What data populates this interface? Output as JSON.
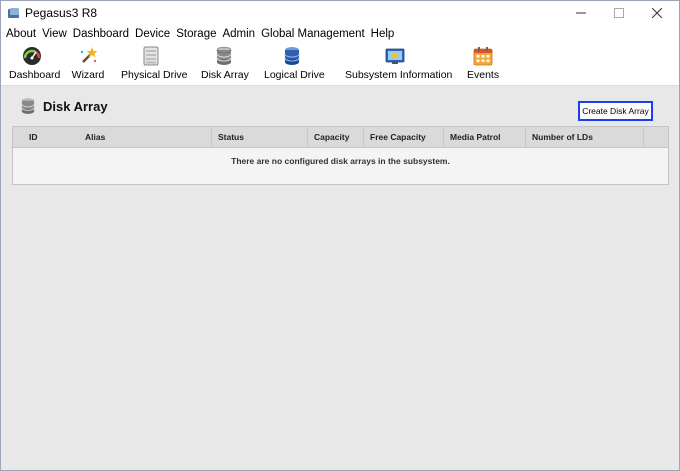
{
  "window": {
    "title": "Pegasus3 R8"
  },
  "menu": [
    "About",
    "View",
    "Dashboard",
    "Device",
    "Storage",
    "Admin",
    "Global Management",
    "Help"
  ],
  "toolbar": {
    "dashboard": "Dashboard",
    "wizard": "Wizard",
    "physical_drive": "Physical Drive",
    "disk_array": "Disk Array",
    "logical_drive": "Logical Drive",
    "subsystem_information": "Subsystem Information",
    "events": "Events"
  },
  "page": {
    "title": "Disk Array",
    "create_button": "Create Disk Array"
  },
  "table": {
    "columns": [
      "ID",
      "Alias",
      "Status",
      "Capacity",
      "Free Capacity",
      "Media Patrol",
      "Number of LDs"
    ],
    "empty_message": "There are no configured disk arrays in the subsystem."
  },
  "colors": {
    "focus_border": "#1a3ef0",
    "header_bg": "#dadada",
    "content_bg": "#e8e8e8"
  }
}
